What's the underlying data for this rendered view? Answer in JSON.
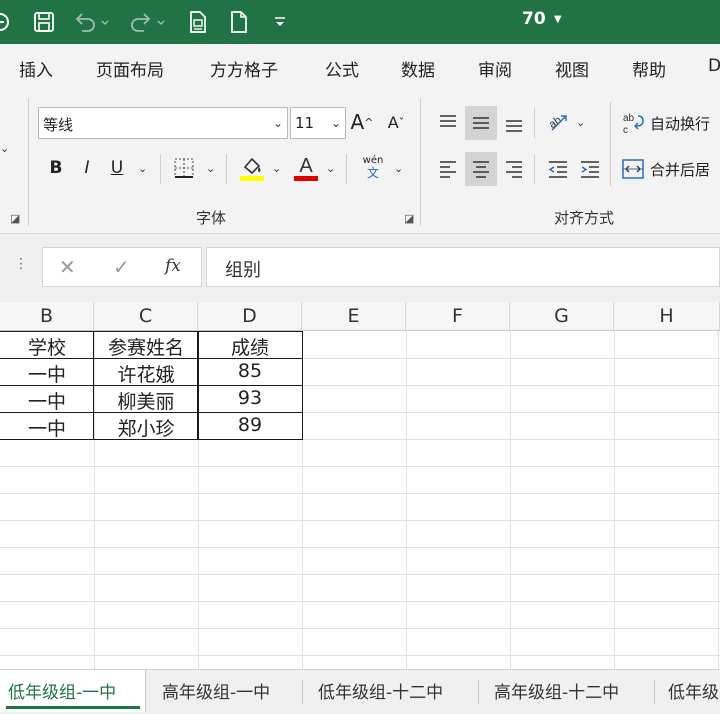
{
  "titlebar": {
    "zoom_title": "70",
    "bg_color": "#217346",
    "icons": [
      "app-icon",
      "save-icon",
      "undo-icon",
      "redo-icon",
      "print-preview-icon",
      "new-file-icon",
      "customize-toolbar-icon"
    ]
  },
  "tabs": [
    "插入",
    "页面布局",
    "方方格子",
    "公式",
    "数据",
    "审阅",
    "视图",
    "帮助",
    "D"
  ],
  "ribbon": {
    "font_name": "等线",
    "font_size": "11",
    "bold": "B",
    "italic": "I",
    "underline": "U",
    "font_group_label": "字体",
    "align_group_label": "对齐方式",
    "wrap_text": "自动换行",
    "merge_center": "合并后居",
    "phonetic_top": "wén",
    "phonetic_bottom": "文",
    "fill_color": "#ffff00",
    "font_color": "#e00000"
  },
  "formula_bar": {
    "fx": "fx",
    "value": "组别"
  },
  "columns": [
    "B",
    "C",
    "D",
    "E",
    "F",
    "G",
    "H"
  ],
  "table": {
    "headers": [
      "学校",
      "参赛姓名",
      "成绩"
    ],
    "rows": [
      [
        "一中",
        "许花娥",
        "85"
      ],
      [
        "一中",
        "柳美丽",
        "93"
      ],
      [
        "一中",
        "郑小珍",
        "89"
      ]
    ]
  },
  "sheets": [
    "低年级组-一中",
    "高年级组-一中",
    "低年级组-十二中",
    "高年级组-十二中",
    "低年级"
  ],
  "active_sheet": "低年级组-一中"
}
